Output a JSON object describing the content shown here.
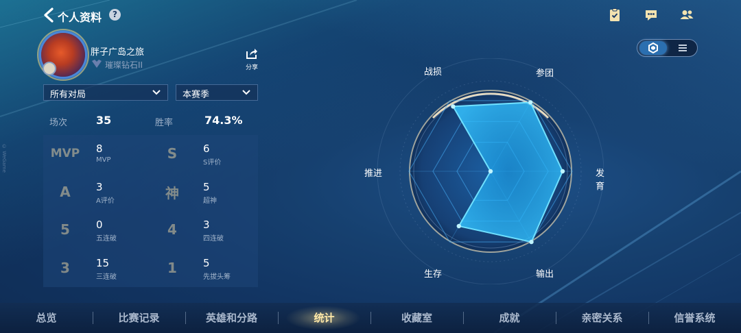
{
  "header": {
    "title": "个人资料",
    "help_icon": "?",
    "icons": [
      "task-clipboard-icon",
      "chat-bubble-icon",
      "friends-icon"
    ]
  },
  "profile": {
    "name": "胖子广岛之旅",
    "rank": "璀璨钻石II",
    "share_label": "分享"
  },
  "filters": {
    "mode": "所有对局",
    "season": "本赛季"
  },
  "summary": {
    "matches_label": "场次",
    "matches_value": "35",
    "winrate_label": "胜率",
    "winrate_value": "74.3%"
  },
  "stats": [
    {
      "icon": "MVP",
      "value": "8",
      "label": "MVP"
    },
    {
      "icon": "S",
      "value": "6",
      "label": "S评价"
    },
    {
      "icon": "A",
      "value": "3",
      "label": "A评价"
    },
    {
      "icon": "神",
      "value": "5",
      "label": "超神"
    },
    {
      "icon": "5",
      "value": "0",
      "label": "五连破"
    },
    {
      "icon": "4",
      "value": "3",
      "label": "四连破"
    },
    {
      "icon": "3",
      "value": "15",
      "label": "三连破"
    },
    {
      "icon": "1",
      "value": "5",
      "label": "先拔头筹"
    }
  ],
  "view_toggle": {
    "selected": "radar",
    "options": [
      "radar-icon",
      "list-icon"
    ]
  },
  "radar": {
    "axes": [
      "战损",
      "参团",
      "发育",
      "输出",
      "生存",
      "推进"
    ],
    "values": [
      0.78,
      0.83,
      0.75,
      0.85,
      0.66,
      0.0
    ],
    "accent": "#2a9ee8"
  },
  "nav": {
    "items": [
      "总览",
      "比赛记录",
      "英雄和分路",
      "统计",
      "收藏室",
      "成就",
      "亲密关系",
      "信誉系统"
    ],
    "active": "统计"
  },
  "watermark": "© WeGame"
}
